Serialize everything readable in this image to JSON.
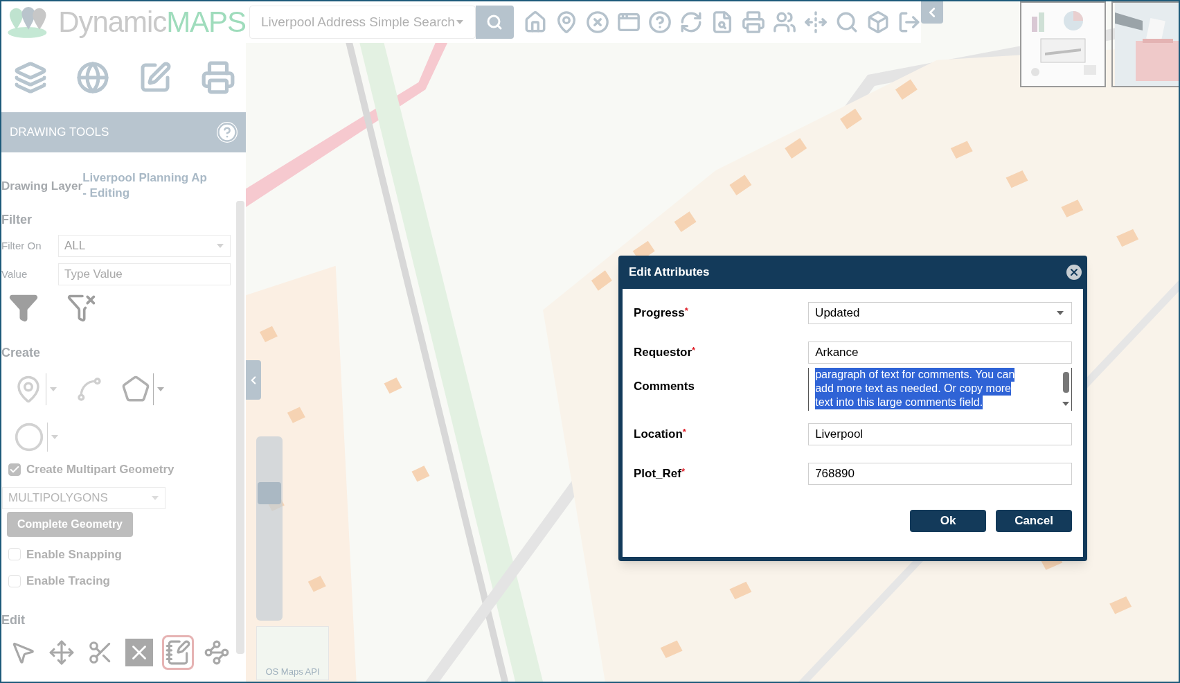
{
  "header": {
    "logo_left": "Dynamic",
    "logo_right": "MAPS",
    "search": {
      "value": "Liverpool Address Simple Search"
    }
  },
  "panel": {
    "title": "DRAWING TOOLS",
    "drawing_layer": {
      "label": "Drawing Layer",
      "value_lines": [
        "Liverpool Planning Ap",
        "- Editing"
      ]
    },
    "filter": {
      "title": "Filter",
      "filter_on": {
        "label": "Filter On",
        "value": "ALL"
      },
      "value": {
        "label": "Value",
        "placeholder": "Type Value"
      }
    },
    "create": {
      "title": "Create"
    },
    "options": [
      {
        "label": "Create Multipart Geometry",
        "checked": true
      },
      {
        "label": "Enable Snapping",
        "checked": false
      },
      {
        "label": "Enable Tracing",
        "checked": false
      }
    ],
    "geometry_type": "MULTIPOLYGONS",
    "complete_button": {
      "label": "Complete Geometry",
      "disabled": true
    },
    "edit": {
      "title": "Edit",
      "tools": [
        {
          "kind": "pointer",
          "selected": false
        },
        {
          "kind": "move",
          "selected": false
        },
        {
          "kind": "cut",
          "selected": false
        },
        {
          "kind": "delete",
          "selected": false
        },
        {
          "kind": "attributes",
          "selected": true
        },
        {
          "kind": "reshape",
          "selected": false
        }
      ]
    }
  },
  "map": {
    "overview_label": "OS Maps API",
    "zoom_slider": {
      "level": 0.72
    }
  },
  "dialog": {
    "title": "Edit Attributes",
    "fields": [
      {
        "label": "Progress",
        "required_mark": "*",
        "kind": "select",
        "value": "Updated"
      },
      {
        "label": "Requestor",
        "required_mark": "*",
        "kind": "text",
        "value": "Arkance"
      },
      {
        "label": "Comments",
        "kind": "textarea",
        "highlighted": true,
        "lines": [
          "paragraph of text for comments. You can",
          "add more text as needed. Or copy more",
          "text into this large comments field."
        ]
      },
      {
        "label": "Location",
        "required_mark": "*",
        "kind": "text",
        "value": "Liverpool"
      },
      {
        "label": "Plot_Ref",
        "required_mark": "*",
        "kind": "text",
        "value": "768890"
      }
    ],
    "buttons": [
      "Ok",
      "Cancel"
    ]
  }
}
